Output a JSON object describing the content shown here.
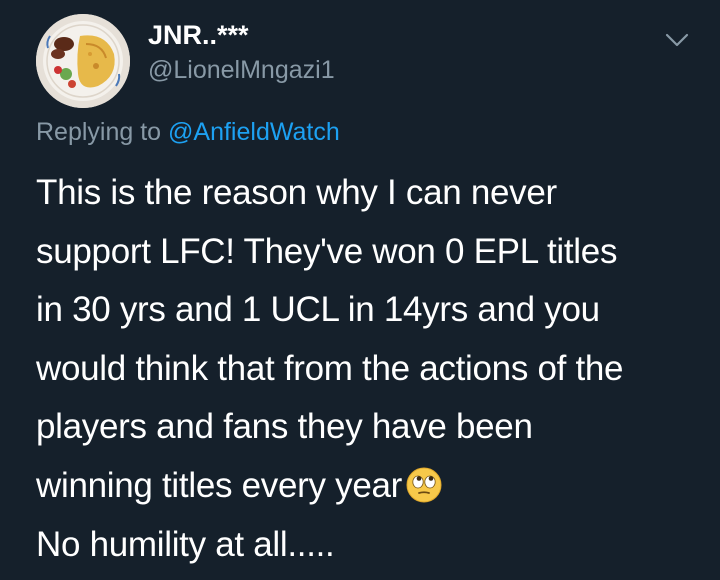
{
  "author": {
    "display_name": "JNR..***",
    "handle": "@LionelMngazi1",
    "avatar_icon": "food-plate-avatar"
  },
  "more_icon": "chevron-down-icon",
  "reply_context": {
    "prefix": "Replying to ",
    "mention": "@AnfieldWatch"
  },
  "tweet": {
    "lines": [
      "This is the reason why I can never",
      "support LFC! They've won 0 EPL titles",
      "in 30 yrs and 1 UCL in 14yrs and you",
      "would think that from the actions of the",
      "players and fans they have been",
      "winning titles every year"
    ],
    "emoji": "face-with-rolling-eyes",
    "closing": "No humility at all....."
  },
  "colors": {
    "background": "#15202b",
    "secondary_text": "#8899a6",
    "link": "#1da1f2",
    "primary_text": "#ffffff"
  }
}
